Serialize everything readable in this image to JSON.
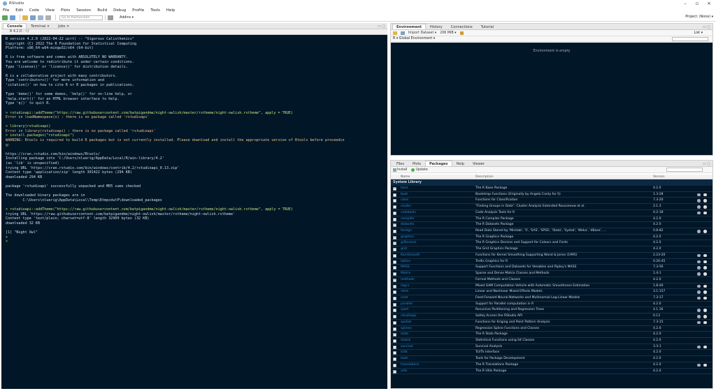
{
  "window": {
    "title": "RStudio"
  },
  "menu": [
    "File",
    "Edit",
    "Code",
    "View",
    "Plots",
    "Session",
    "Build",
    "Debug",
    "Profile",
    "Tools",
    "Help"
  ],
  "toolbar": {
    "goto_placeholder": "Go to file/function",
    "addins": "Addins ▾",
    "project": "Project: (None) ▾"
  },
  "console": {
    "tabs": [
      "Console",
      "Terminal ×",
      "Jobs ×"
    ],
    "version": "R 4.2.0 · ~/",
    "lines": [
      {
        "t": "normal",
        "s": "R version 4.2.0 (2022-04-22 ucrt) -- \"Vigorous Calisthenics\""
      },
      {
        "t": "normal",
        "s": "Copyright (C) 2022 The R Foundation for Statistical Computing"
      },
      {
        "t": "normal",
        "s": "Platform: x86_64-w64-mingw32/x64 (64-bit)"
      },
      {
        "t": "blank",
        "s": ""
      },
      {
        "t": "normal",
        "s": "R is free software and comes with ABSOLUTELY NO WARRANTY."
      },
      {
        "t": "normal",
        "s": "You are welcome to redistribute it under certain conditions."
      },
      {
        "t": "normal",
        "s": "Type 'license()' or 'licence()' for distribution details."
      },
      {
        "t": "blank",
        "s": ""
      },
      {
        "t": "normal",
        "s": "R is a collaborative project with many contributors."
      },
      {
        "t": "normal",
        "s": "Type 'contributors()' for more information and"
      },
      {
        "t": "normal",
        "s": "'citation()' on how to cite R or R packages in publications."
      },
      {
        "t": "blank",
        "s": ""
      },
      {
        "t": "normal",
        "s": "Type 'demo()' for some demos, 'help()' for on-line help, or"
      },
      {
        "t": "normal",
        "s": "'help.start()' for an HTML browser interface to help."
      },
      {
        "t": "normal",
        "s": "Type 'q()' to quit R."
      },
      {
        "t": "blank",
        "s": ""
      },
      {
        "t": "prompt",
        "s": "> rstudioapi::addTheme(\"https://raw.githubusercontent.com/batpigandme/night-owlish/master/rstheme/night-owlish.rstheme\", apply = TRUE)"
      },
      {
        "t": "err",
        "s": "Error in loadNamespace(x) : there is no package called 'rstudioapi'"
      },
      {
        "t": "blank",
        "s": ""
      },
      {
        "t": "prompt",
        "s": "> library(rstudioapi)"
      },
      {
        "t": "err",
        "s": "Error in library(rstudioapi) : there is no package called 'rstudioapi'"
      },
      {
        "t": "prompt",
        "s": "> install.packages(\"rstudioapi\")"
      },
      {
        "t": "err",
        "s": "WARNING: Rtools is required to build R packages but is not currently installed. Please download and install the appropriate version of Rtools before proceedin"
      },
      {
        "t": "err",
        "s": "g:"
      },
      {
        "t": "blank",
        "s": ""
      },
      {
        "t": "normal",
        "s": "https://cran.rstudio.com/bin/windows/Rtools/"
      },
      {
        "t": "normal",
        "s": "Installing package into 'C:/Users/nluerig/AppData/Local/R/win-library/4.2'"
      },
      {
        "t": "normal",
        "s": "(as 'lib' is unspecified)"
      },
      {
        "t": "normal",
        "s": "trying URL 'https://cran.rstudio.com/bin/windows/contrib/4.2/rstudioapi_0.13.zip'"
      },
      {
        "t": "normal",
        "s": "Content type 'application/zip' length 301422 bytes (294 KB)"
      },
      {
        "t": "normal",
        "s": "downloaded 294 KB"
      },
      {
        "t": "blank",
        "s": ""
      },
      {
        "t": "normal",
        "s": "package 'rstudioapi' successfully unpacked and MD5 sums checked"
      },
      {
        "t": "blank",
        "s": ""
      },
      {
        "t": "normal",
        "s": "The downloaded binary packages are in"
      },
      {
        "t": "normal",
        "s": "        C:\\Users\\nluerig\\AppData\\Local\\Temp\\RtmpcdutP\\downloaded_packages"
      },
      {
        "t": "blank",
        "s": ""
      },
      {
        "t": "prompt",
        "s": "> rstudioapi::addTheme(\"https://raw.githubusercontent.com/batpigandme/night-owlish/master/rstheme/night-owlish.rstheme\", apply = TRUE)"
      },
      {
        "t": "normal",
        "s": "trying URL 'https://raw.githubusercontent.com/batpigandme/night-owlish/master/rstheme/night-owlish.rstheme'"
      },
      {
        "t": "normal",
        "s": "Content type 'text/plain; charset=utf-8' length 32909 bytes (32 KB)"
      },
      {
        "t": "normal",
        "s": "downloaded 32 KB"
      },
      {
        "t": "blank",
        "s": ""
      },
      {
        "t": "normal",
        "s": "[1] \"Night Owl\""
      },
      {
        "t": "prompt",
        "s": ">"
      },
      {
        "t": "prompt",
        "s": ">"
      }
    ]
  },
  "env": {
    "tabs": [
      "Environment",
      "History",
      "Connections",
      "Tutorial"
    ],
    "toolbar": [
      "Import Dataset ▾",
      "206 MiB ▾"
    ],
    "list_label": "List ▾",
    "scope": "R ▾  Global Environment ▾",
    "empty_text": "Environment is empty"
  },
  "files": {
    "tabs": [
      "Files",
      "Plots",
      "Packages",
      "Help",
      "Viewer"
    ],
    "toolbar": [
      "Install",
      "Update"
    ],
    "columns": {
      "name": "Name",
      "description": "Description",
      "version": "Version"
    },
    "group": "System Library",
    "packages": [
      {
        "n": "base",
        "d": "The R Base Package",
        "v": "4.2.0",
        "c": true,
        "i": false
      },
      {
        "n": "boot",
        "d": "Bootstrap Functions (Originally by Angelo Canty for S)",
        "v": "1.3-28",
        "c": false,
        "i": true
      },
      {
        "n": "class",
        "d": "Functions for Classification",
        "v": "7.3-20",
        "c": false,
        "i": true
      },
      {
        "n": "cluster",
        "d": "\"Finding Groups in Data\": Cluster Analysis Extended Rousseeuw et al.",
        "v": "2.1.3",
        "c": false,
        "i": true
      },
      {
        "n": "codetools",
        "d": "Code Analysis Tools for R",
        "v": "0.2-18",
        "c": false,
        "i": true
      },
      {
        "n": "compiler",
        "d": "The R Compiler Package",
        "v": "4.2.0",
        "c": false,
        "i": false
      },
      {
        "n": "datasets",
        "d": "The R Datasets Package",
        "v": "4.2.0",
        "c": true,
        "i": false
      },
      {
        "n": "foreign",
        "d": "Read Data Stored by 'Minitab', 'S', 'SAS', 'SPSS', 'Stata', 'Systat', 'Weka', 'dBase', ...",
        "v": "0.8-82",
        "c": false,
        "i": true
      },
      {
        "n": "graphics",
        "d": "The R Graphics Package",
        "v": "4.2.0",
        "c": true,
        "i": false
      },
      {
        "n": "grDevices",
        "d": "The R Graphics Devices and Support for Colours and Fonts",
        "v": "4.2.0",
        "c": true,
        "i": false
      },
      {
        "n": "grid",
        "d": "The Grid Graphics Package",
        "v": "4.2.0",
        "c": false,
        "i": false
      },
      {
        "n": "KernSmooth",
        "d": "Functions for Kernel Smoothing Supporting Wand & Jones (1995)",
        "v": "2.23-20",
        "c": false,
        "i": true
      },
      {
        "n": "lattice",
        "d": "Trellis Graphics for R",
        "v": "0.20-45",
        "c": false,
        "i": true
      },
      {
        "n": "MASS",
        "d": "Support Functions and Datasets for Venables and Ripley's MASS",
        "v": "7.3-56",
        "c": false,
        "i": true
      },
      {
        "n": "Matrix",
        "d": "Sparse and Dense Matrix Classes and Methods",
        "v": "1.4-1",
        "c": false,
        "i": true
      },
      {
        "n": "methods",
        "d": "Formal Methods and Classes",
        "v": "4.2.0",
        "c": true,
        "i": false
      },
      {
        "n": "mgcv",
        "d": "Mixed GAM Computation Vehicle with Automatic Smoothness Estimation",
        "v": "1.8-40",
        "c": false,
        "i": true
      },
      {
        "n": "nlme",
        "d": "Linear and Nonlinear Mixed Effects Models",
        "v": "3.1-157",
        "c": false,
        "i": true
      },
      {
        "n": "nnet",
        "d": "Feed-Forward Neural Networks and Multinomial Log-Linear Models",
        "v": "7.3-17",
        "c": false,
        "i": true
      },
      {
        "n": "parallel",
        "d": "Support for Parallel computation in R",
        "v": "4.2.0",
        "c": false,
        "i": false
      },
      {
        "n": "rpart",
        "d": "Recursive Partitioning and Regression Trees",
        "v": "4.1.16",
        "c": false,
        "i": true
      },
      {
        "n": "rstudioapi",
        "d": "Safely Access the RStudio API",
        "v": "0.13",
        "c": false,
        "i": true
      },
      {
        "n": "spatial",
        "d": "Functions for Kriging and Point Pattern Analysis",
        "v": "7.3-15",
        "c": false,
        "i": true
      },
      {
        "n": "splines",
        "d": "Regression Spline Functions and Classes",
        "v": "4.2.0",
        "c": false,
        "i": false
      },
      {
        "n": "stats",
        "d": "The R Stats Package",
        "v": "4.2.0",
        "c": true,
        "i": false
      },
      {
        "n": "stats4",
        "d": "Statistical Functions using S4 Classes",
        "v": "4.2.0",
        "c": false,
        "i": false
      },
      {
        "n": "survival",
        "d": "Survival Analysis",
        "v": "3.3-1",
        "c": false,
        "i": true
      },
      {
        "n": "tcltk",
        "d": "Tcl/Tk Interface",
        "v": "4.2.0",
        "c": false,
        "i": false
      },
      {
        "n": "tools",
        "d": "Tools for Package Development",
        "v": "4.2.0",
        "c": false,
        "i": false
      },
      {
        "n": "translations",
        "d": "The R Translations Package",
        "v": "4.2.0",
        "c": false,
        "i": true
      },
      {
        "n": "utils",
        "d": "The R Utils Package",
        "v": "4.2.0",
        "c": true,
        "i": false
      }
    ]
  },
  "colors": {
    "console_bg": "#011627",
    "prompt": "#c5e478",
    "error": "#ecc48d",
    "text": "#d6deeb",
    "link": "#2f8bd5"
  }
}
